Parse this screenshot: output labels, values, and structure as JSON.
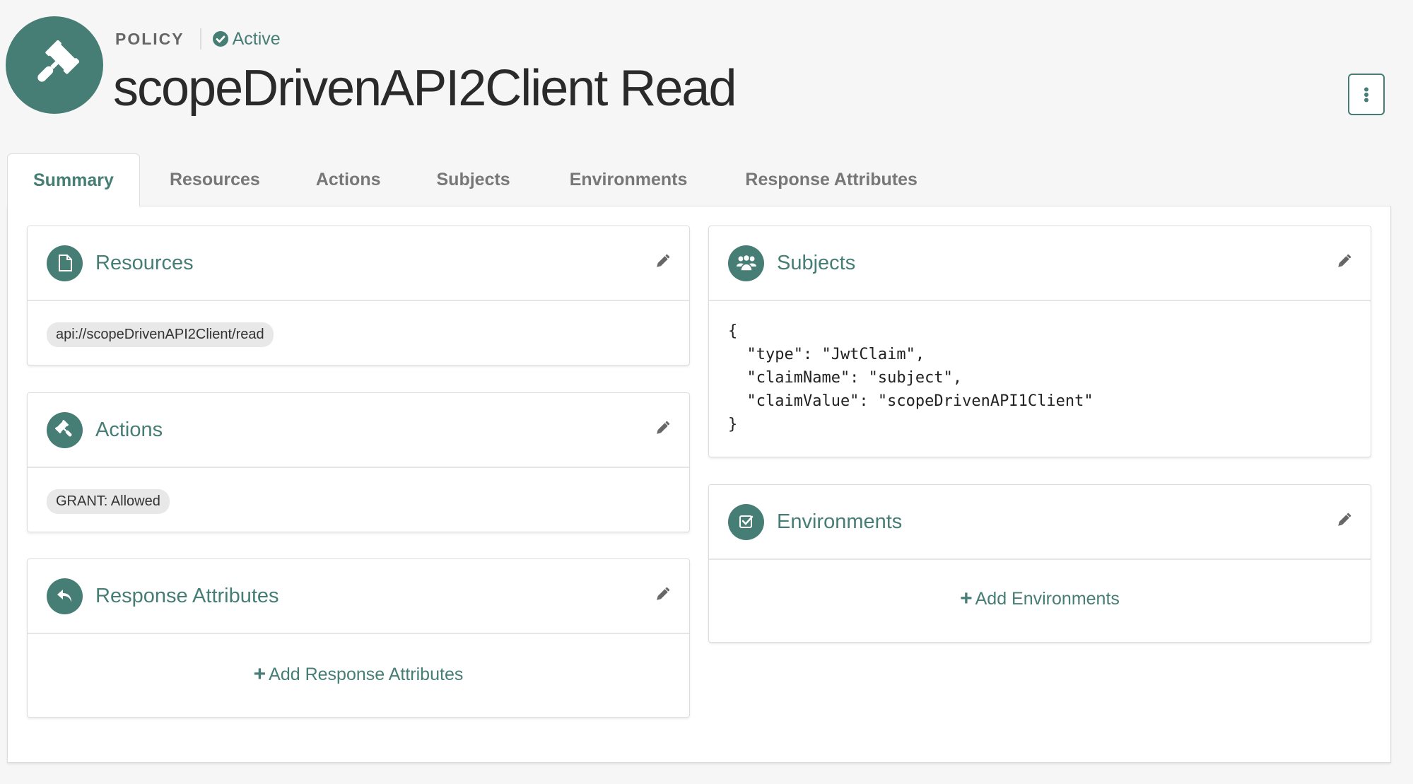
{
  "header": {
    "type_label": "POLICY",
    "status": "Active",
    "title": "scopeDrivenAPI2Client Read",
    "avatar_icon": "gavel-icon",
    "menu_icon": "kebab-vertical-icon"
  },
  "tabs": [
    {
      "label": "Summary",
      "active": true
    },
    {
      "label": "Resources",
      "active": false
    },
    {
      "label": "Actions",
      "active": false
    },
    {
      "label": "Subjects",
      "active": false
    },
    {
      "label": "Environments",
      "active": false
    },
    {
      "label": "Response Attributes",
      "active": false
    }
  ],
  "cards": {
    "resources": {
      "title": "Resources",
      "icon": "file-icon",
      "items": [
        "api://scopeDrivenAPI2Client/read"
      ]
    },
    "actions": {
      "title": "Actions",
      "icon": "gavel-icon",
      "items": [
        "GRANT: Allowed"
      ]
    },
    "response_attributes": {
      "title": "Response Attributes",
      "icon": "reply-icon",
      "add_label": "Add Response Attributes"
    },
    "subjects": {
      "title": "Subjects",
      "icon": "users-icon",
      "code": "{\n  \"type\": \"JwtClaim\",\n  \"claimName\": \"subject\",\n  \"claimValue\": \"scopeDrivenAPI1Client\"\n}"
    },
    "environments": {
      "title": "Environments",
      "icon": "checkbox-icon",
      "add_label": "Add Environments"
    }
  },
  "colors": {
    "accent": "#467d75",
    "background": "#f6f6f6",
    "tab_inactive": "#777777",
    "pill_bg": "#e8e8e8"
  }
}
